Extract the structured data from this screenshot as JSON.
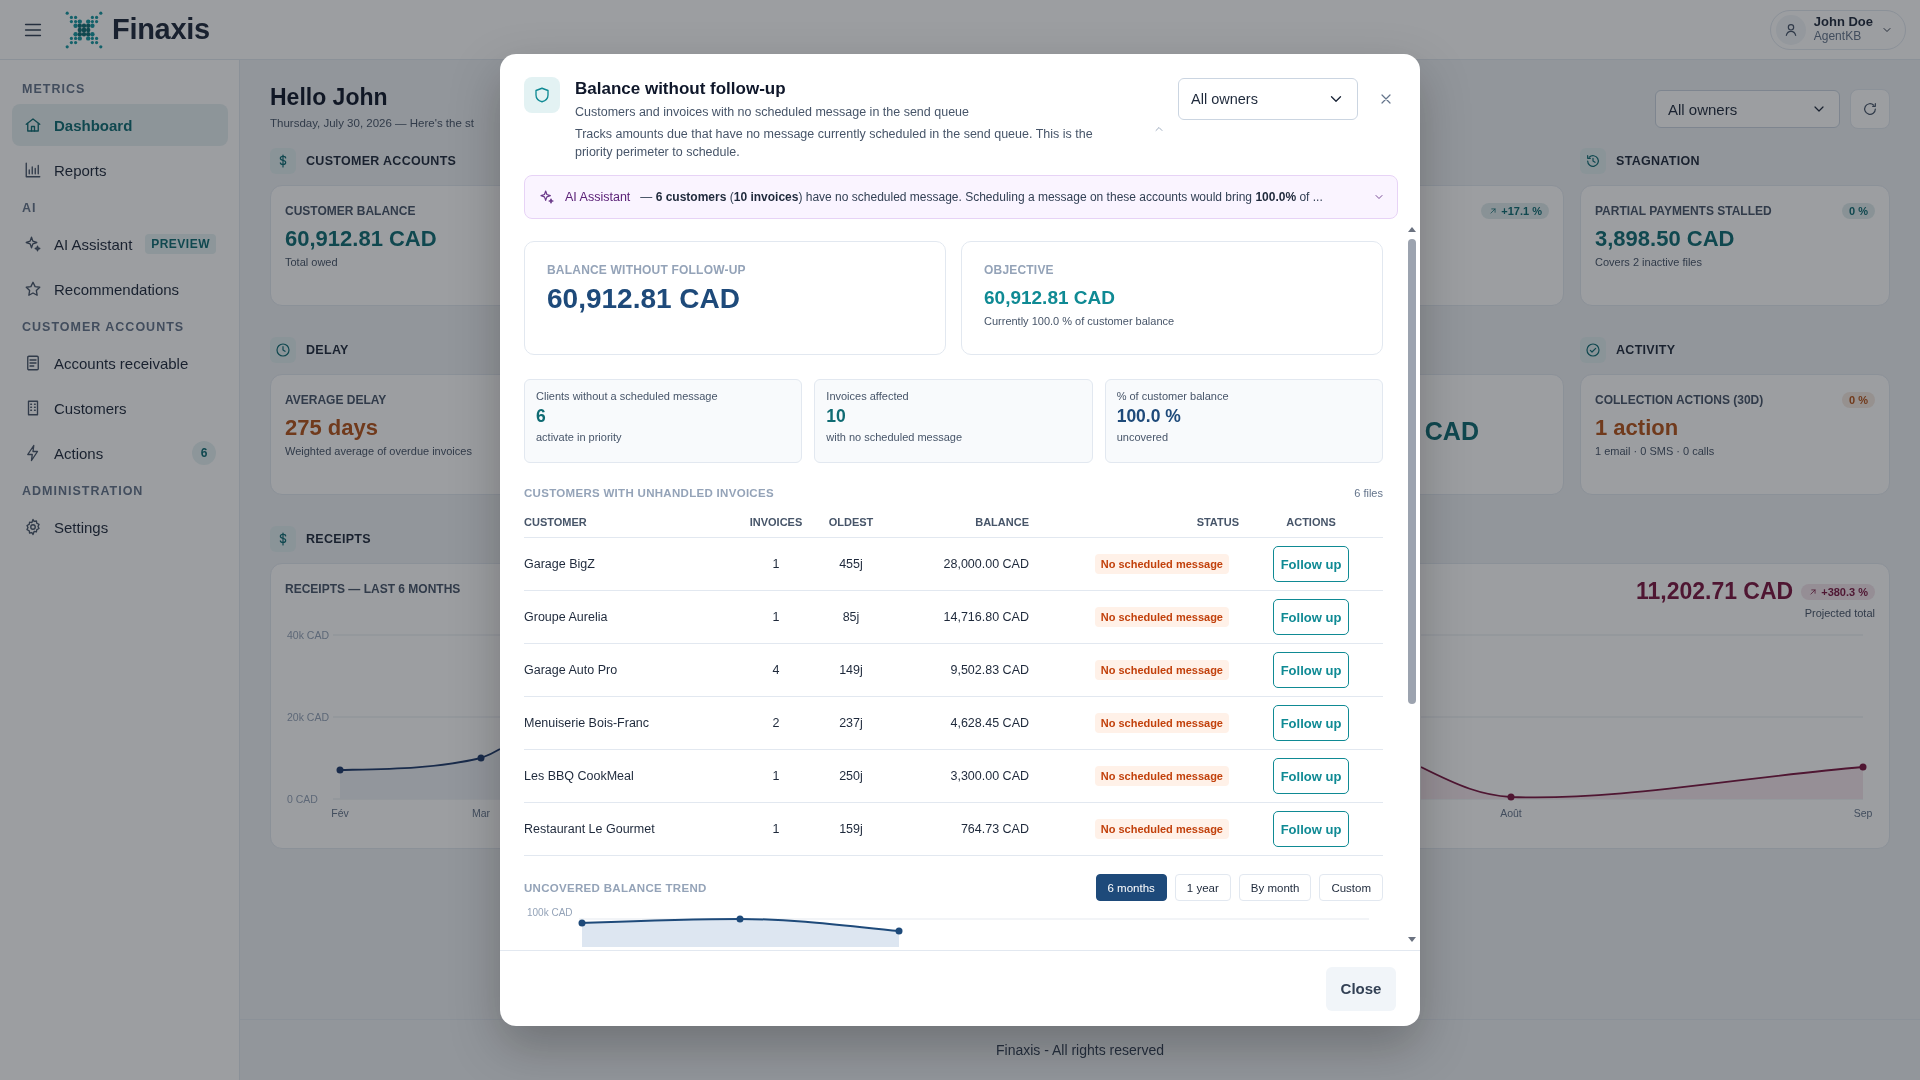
{
  "topbar": {
    "brand": "Finaxis",
    "user": {
      "name": "John Doe",
      "role": "AgentKB"
    }
  },
  "sidebar": {
    "sections": [
      {
        "title": "METRICS",
        "items": [
          {
            "label": "Dashboard",
            "selected": true
          },
          {
            "label": "Reports",
            "selected": false
          }
        ]
      },
      {
        "title": "AI",
        "items": [
          {
            "label": "AI Assistant",
            "selected": false,
            "badge": {
              "text": "PREVIEW",
              "kind": "tag"
            }
          },
          {
            "label": "Recommendations",
            "selected": false
          }
        ]
      },
      {
        "title": "CUSTOMER ACCOUNTS",
        "items": [
          {
            "label": "Accounts receivable",
            "selected": false
          },
          {
            "label": "Customers",
            "selected": false
          },
          {
            "label": "Actions",
            "selected": false,
            "badge": {
              "text": "6",
              "kind": "count"
            }
          }
        ]
      },
      {
        "title": "ADMINISTRATION",
        "items": [
          {
            "label": "Settings",
            "selected": false
          }
        ]
      }
    ]
  },
  "dashboard": {
    "greeting": "Hello John",
    "date_line": "Thursday, July 30, 2026 — Here's the st",
    "owner_filter": "All owners",
    "groups": [
      {
        "title": "CUSTOMER ACCOUNTS",
        "cards": [
          {
            "label": "CUSTOMER BALANCE",
            "value": "60,912.81 CAD",
            "note": "Total owed",
            "kind": "amount"
          },
          {
            "badge": "+17.1 %",
            "kind": "amount"
          }
        ]
      },
      {
        "title": "STAGNATION",
        "cards": [
          {
            "label": "PARTIAL PAYMENTS STALLED",
            "value": "3,898.50 CAD",
            "note": "Covers 2 inactive files",
            "badge": "0 %",
            "kind": "amount"
          }
        ]
      },
      {
        "title": "DELAY",
        "cards": [
          {
            "label": "AVERAGE DELAY",
            "value": "275 days",
            "note": "Weighted average of overdue invoices",
            "kind": "alert"
          },
          {
            "value": "CAD",
            "kind": "amount"
          }
        ]
      },
      {
        "title": "ACTIVITY",
        "cards": [
          {
            "label": "COLLECTION ACTIONS (30D)",
            "value": "1 action",
            "note": "1 email · 0 SMS · 0 calls",
            "badge": "0 %",
            "kind": "alert"
          }
        ]
      }
    ],
    "receipts": {
      "title": "RECEIPTS",
      "chart_title": "RECEIPTS — LAST 6 MONTHS",
      "projected_value": "11,202.71 CAD",
      "projected_badge": "+380.3 %",
      "projected_label": "Projected total",
      "right_axis_labels": [
        "Août",
        "Sep"
      ],
      "y_axis_labels": [
        "40k CAD",
        "20k CAD",
        "0 CAD"
      ],
      "left_axis_labels": [
        "Fév",
        "Mar"
      ]
    },
    "footer": "Finaxis - All rights reserved"
  },
  "modal": {
    "title": "Balance without follow-up",
    "subtitle": "Customers and invoices with no scheduled message in the send queue",
    "description": "Tracks amounts due that have no message currently scheduled in the send queue. This is the priority perimeter to schedule.",
    "description_expanded": true,
    "owner_select": "All owners",
    "ai_banner": {
      "label": "AI Assistant",
      "message": "— **6 customers** (**10 invoices**) have no scheduled message. Scheduling a message on these accounts would bring **100.0%** of ...",
      "expanded": false
    },
    "summary": [
      {
        "kind": "primary",
        "label": "BALANCE WITHOUT FOLLOW-UP",
        "value": "60,912.81 CAD"
      },
      {
        "kind": "objective",
        "label": "OBJECTIVE",
        "value": "60,912.81 CAD",
        "note": "Currently 100.0 % of customer balance"
      }
    ],
    "stats": [
      {
        "label": "Clients without a scheduled message",
        "value": "6",
        "note": "activate in priority",
        "color": "#0f6b73"
      },
      {
        "label": "Invoices affected",
        "value": "10",
        "note": "with no scheduled message",
        "color": "#0f6b73"
      },
      {
        "label": "% of customer balance",
        "value": "100.0 %",
        "note": "uncovered",
        "color": "#1e4a7a"
      }
    ],
    "table": {
      "title": "CUSTOMERS WITH UNHANDLED INVOICES",
      "count": "6 files",
      "columns": [
        "CUSTOMER",
        "INVOICES",
        "OLDEST",
        "BALANCE",
        "STATUS",
        "ACTIONS"
      ],
      "rows": [
        {
          "customer": "Garage BigZ",
          "invoices": "1",
          "oldest": "455j",
          "balance": "28,000.00 CAD",
          "status": "No scheduled message",
          "action": "Follow up"
        },
        {
          "customer": "Groupe Aurelia",
          "invoices": "1",
          "oldest": "85j",
          "balance": "14,716.80 CAD",
          "status": "No scheduled message",
          "action": "Follow up"
        },
        {
          "customer": "Garage Auto Pro",
          "invoices": "4",
          "oldest": "149j",
          "balance": "9,502.83 CAD",
          "status": "No scheduled message",
          "action": "Follow up"
        },
        {
          "customer": "Menuiserie Bois-Franc",
          "invoices": "2",
          "oldest": "237j",
          "balance": "4,628.45 CAD",
          "status": "No scheduled message",
          "action": "Follow up"
        },
        {
          "customer": "Les BBQ CookMeal",
          "invoices": "1",
          "oldest": "250j",
          "balance": "3,300.00 CAD",
          "status": "No scheduled message",
          "action": "Follow up"
        },
        {
          "customer": "Restaurant Le Gourmet",
          "invoices": "1",
          "oldest": "159j",
          "balance": "764.73 CAD",
          "status": "No scheduled message",
          "action": "Follow up"
        }
      ]
    },
    "trend": {
      "title": "UNCOVERED BALANCE TREND",
      "periods": [
        {
          "label": "6 months",
          "selected": true
        },
        {
          "label": "1 year",
          "selected": false
        },
        {
          "label": "By month",
          "selected": false
        },
        {
          "label": "Custom",
          "selected": false
        }
      ],
      "tick": "100k CAD"
    },
    "close_button": "Close"
  }
}
